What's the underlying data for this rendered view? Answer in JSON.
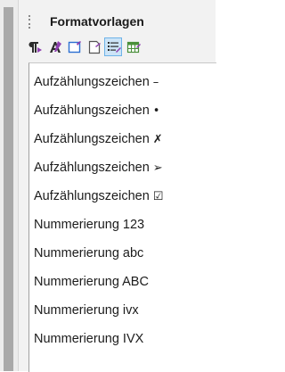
{
  "panel": {
    "title": "Formatvorlagen"
  },
  "toolbar": {
    "buttons": [
      {
        "icon": "paragraph-styles-icon"
      },
      {
        "icon": "character-styles-icon"
      },
      {
        "icon": "frame-styles-icon"
      },
      {
        "icon": "page-styles-icon"
      },
      {
        "icon": "list-styles-icon",
        "active": true
      },
      {
        "icon": "table-styles-icon"
      }
    ]
  },
  "list": {
    "items": [
      {
        "label": "Aufzählungszeichen",
        "symbol": "–"
      },
      {
        "label": "Aufzählungszeichen",
        "symbol": "•"
      },
      {
        "label": "Aufzählungszeichen",
        "symbol": "✗"
      },
      {
        "label": "Aufzählungszeichen",
        "symbol": "➢"
      },
      {
        "label": "Aufzählungszeichen",
        "symbol": "☑"
      },
      {
        "label": "Nummerierung 123"
      },
      {
        "label": "Nummerierung abc"
      },
      {
        "label": "Nummerierung ABC"
      },
      {
        "label": "Nummerierung ivx"
      },
      {
        "label": "Nummerierung IVX"
      }
    ]
  },
  "colors": {
    "active_button_bg": "#cce4f7",
    "active_button_border": "#6eb3e8",
    "panel_bg": "#f2f2f2"
  }
}
